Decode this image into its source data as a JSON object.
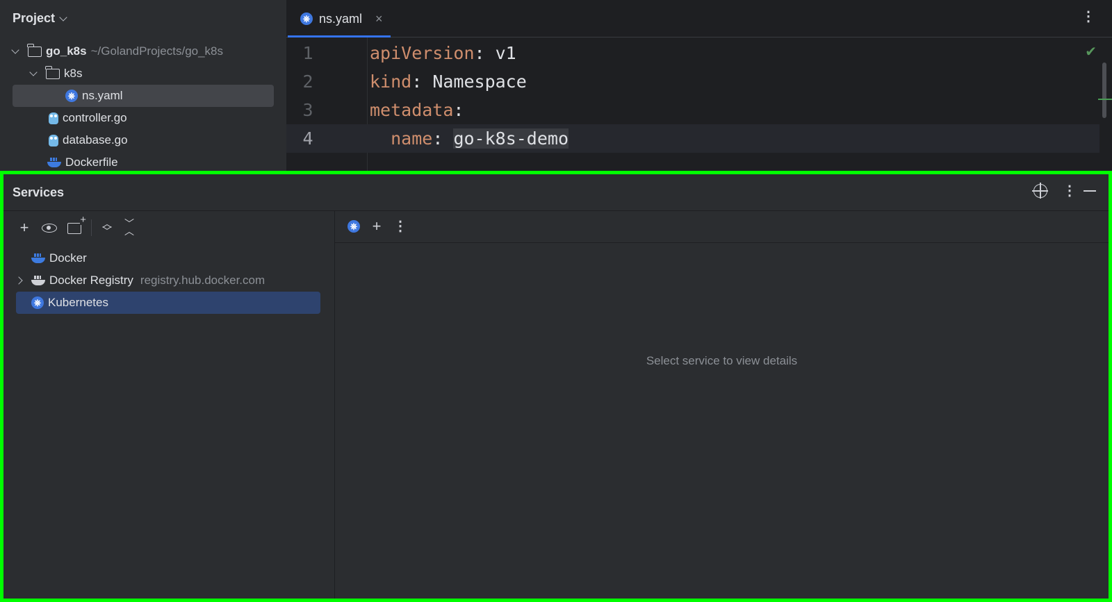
{
  "project": {
    "title": "Project",
    "root": {
      "name": "go_k8s",
      "path": "~/GolandProjects/go_k8s"
    },
    "items": [
      {
        "label": "k8s"
      },
      {
        "label": "ns.yaml"
      },
      {
        "label": "controller.go"
      },
      {
        "label": "database.go"
      },
      {
        "label": "Dockerfile"
      }
    ]
  },
  "editor": {
    "tab_label": "ns.yaml",
    "lines": [
      {
        "num": "1",
        "key": "apiVersion",
        "sep": ": ",
        "value": "v1"
      },
      {
        "num": "2",
        "key": "kind",
        "sep": ": ",
        "value": "Namespace"
      },
      {
        "num": "3",
        "key": "metadata",
        "sep": ":",
        "value": ""
      },
      {
        "num": "4",
        "indent": "  ",
        "key": "name",
        "sep": ": ",
        "value": "go-k8s-demo"
      }
    ]
  },
  "services": {
    "title": "Services",
    "tree": [
      {
        "label": "Docker",
        "detail": ""
      },
      {
        "label": "Docker Registry",
        "detail": "registry.hub.docker.com"
      },
      {
        "label": "Kubernetes",
        "detail": ""
      }
    ],
    "empty_message": "Select service to view details"
  },
  "icons": {
    "kubernetes": "kubernetes-icon",
    "go": "go-file-icon",
    "docker": "docker-icon",
    "folder": "folder-icon"
  },
  "colors": {
    "accent": "#3574f0",
    "selection": "#2e436e",
    "highlight_border": "#00ff00",
    "yaml_key": "#cf8e6d"
  }
}
